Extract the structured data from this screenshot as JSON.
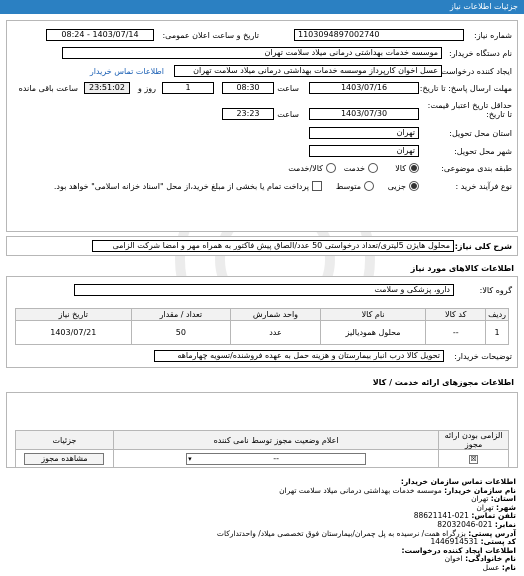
{
  "header": {
    "title": "جزئیات اطلاعات نیاز"
  },
  "form": {
    "need_number_label": "شماره نیاز:",
    "need_number": "1103094897002740",
    "announce_label": "تاریخ و ساعت اعلان عمومی:",
    "announce_value": "1403/07/14 - 08:24",
    "buyer_label": "نام دستگاه خریدار:",
    "buyer_value": "موسسه خدمات بهداشتی درمانی میلاد سلامت تهران",
    "creator_label": "ایجاد کننده درخواست:",
    "creator_value": "عسل اخوان کارپرداز موسسه خدمات بهداشتی درمانی میلاد سلامت تهران",
    "buyer_contact_link": "اطلاعات تماس خریدار",
    "reply_deadline_label": "مهلت ارسال پاسخ: تا تاریخ:",
    "reply_date": "1403/07/16",
    "time_label": "ساعت",
    "reply_time": "08:30",
    "day_count": "1",
    "day_label": "روز و",
    "countdown": "23:51:02",
    "remaining_label": "ساعت باقی مانده",
    "validity_label": "حداقل تاریخ اعتبار قیمت: تا تاریخ:",
    "validity_date": "1403/07/30",
    "validity_time": "23:23",
    "province_label": "استان محل تحویل:",
    "province_value": "تهران",
    "city_label": "شهر محل تحویل:",
    "city_value": "تهران",
    "category_label": "طبقه بندی موضوعی:",
    "category_options": [
      "کالا",
      "خدمت",
      "کالا/خدمت"
    ],
    "process_label": "نوع فرآیند خرید :",
    "process_options": [
      "جزیی",
      "متوسط"
    ],
    "payment_text": "پرداخت تمام یا بخشی از مبلغ خرید،از محل \"اسناد خزانه اسلامی\" خواهد بود."
  },
  "need_desc": {
    "label": "شرح کلی نیاز:",
    "value": "محلول هایژن 5لیتری/تعداد درخواستی 50 عدد/الصاق پیش فاکتور به همراه مهر و امضا شرکت الزامی"
  },
  "goods": {
    "title": "اطلاعات کالاهای مورد نیاز",
    "group_label": "گروه کالا:",
    "group_value": "دارو، پزشکی و سلامت",
    "columns": [
      "ردیف",
      "کد کالا",
      "نام کالا",
      "واحد شمارش",
      "تعداد / مقدار",
      "تاریخ نیاز"
    ],
    "rows": [
      {
        "row": "1",
        "code": "--",
        "name": "محلول هموديالیز",
        "unit": "عدد",
        "qty": "50",
        "date": "1403/07/21"
      }
    ],
    "buyer_notes_label": "توضیحات خریدار:",
    "buyer_notes": "تحویل کالا درب انبار بیمارستان و هزینه حمل به عهده فروشنده/تسویه چهارماهه"
  },
  "permits": {
    "title": "اطلاعات مجوزهای ارائه خدمت / کالا",
    "columns": [
      "الزامی بودن ارائه مجوز",
      "اعلام وضعیت مجوز توسط نامی کننده",
      "جزئیات"
    ],
    "status_value": "--",
    "details_button": "مشاهده مجوز"
  },
  "contact": {
    "title": "اطلاعات تماس سازمان خریدار:",
    "org_label": "نام سازمان خریدار:",
    "org_value": "موسسه خدمات بهداشتی درمانی میلاد سلامت تهران",
    "province_label": "استان:",
    "province_value": "تهران",
    "city_label": "شهر:",
    "city_value": "تهران",
    "phone_label": "تلفن تماس:",
    "phone_value": "021-88621141",
    "fax_label": "نمابر:",
    "fax_value": "021-82032046",
    "address_label": "آدرس پستی:",
    "address_value": "بزرگراه همت/ نرسیده به پل چمران/بیمارستان فوق تخصصی میلاد/ واحدتدارکات",
    "postal_label": "کد پستی:",
    "postal_value": "1446914531",
    "creator_info_title": "اطلاعات ایجاد کننده درخواست:",
    "name_label": "نام خانوادگی:",
    "name_value": "اخوان",
    "first_label": "نام:",
    "first_value": "عسل"
  },
  "colors": {
    "header": "#2b80c2",
    "link": "#1a5fb4"
  }
}
